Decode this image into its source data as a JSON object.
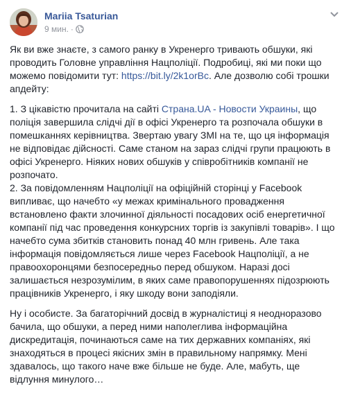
{
  "post": {
    "author": "Mariia Tsaturian",
    "time": "9 мин.",
    "separator": "·",
    "icons": {
      "privacy": "globe-icon",
      "menu": "chevron-down-icon",
      "avatar": "profile-photo"
    },
    "colors": {
      "author": "#385898",
      "link": "#365899",
      "text": "#1d2129",
      "meta": "#90949c"
    },
    "paragraph1": {
      "before": "Як ви вже знаєте, з самого ранку в Укренерго тривають обшуки, які проводить Головне управління Нацполіції. Подробиці, які ми поки що можемо повідомити тут: ",
      "link": "https://bit.ly/2k1orBc",
      "after": ". Але дозволю собі трошки апдейту:"
    },
    "paragraph2": {
      "before": "1. З цікавістю прочитала на сайті ",
      "link": "Страна.UA - Новости Украины",
      "after": ", що поліція завершила слідчі дії в офісі Укренерго та розпочала обшуки в помешканнях керівництва. Звертаю увагу ЗМІ на те, що ця інформація не відповідає дійсності. Саме станом на зараз слідчі групи працюють в офісі Укренерго. Ніяких нових обшуків у співробітників компанії не розпочато.",
      "item2": "2. За повідомленням Нацполіції на офіційній сторінці у Facebook випливає, що начебто «у межах кримінального провадження встановлено факти злочинної діяльності посадових осіб енергетичної компанії під час проведення конкурсних торгів із закупівлі товарів». І що начебто сума збитків становить понад 40 млн гривень. Але така інформація повідомляється лише через Facebook Нацполіції, а не правоохоронцями безпосередньо перед обшуком. Наразі досі залишається незрозумілим, в яких саме правопорушеннях підозрюють працівників Укренерго, і яку шкоду вони заподіяли."
    },
    "paragraph3": "Ну і особисте. За багаторічний досвід в журналістиці я неодноразово бачила, що обшуки, а перед ними наполеглива інформаційна дискредитація, починаються саме на тих державних компаніях, які знаходяться в процесі якісних змін в правильному напрямку. Мені здавалось, що такого наче вже більше не буде. Але, мабуть, ще відлуння минулого…"
  }
}
